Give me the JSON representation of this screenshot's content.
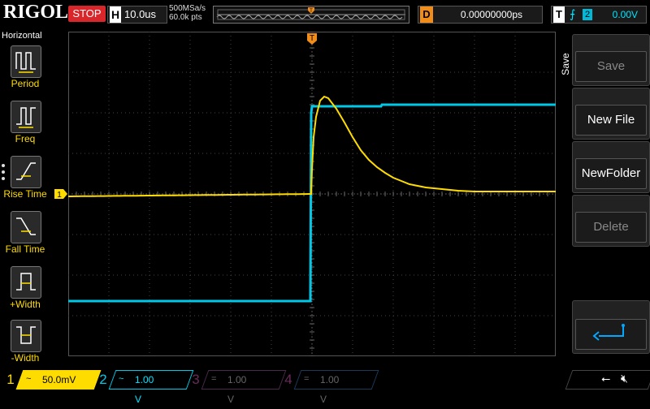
{
  "brand": "RIGOL",
  "status": "STOP",
  "horizontal": {
    "key": "H",
    "timebase": "10.0us",
    "sample_rate": "500MSa/s",
    "memory_depth": "60.0k pts"
  },
  "delay": {
    "key": "D",
    "value": "0.00000000ps"
  },
  "trigger": {
    "key": "T",
    "source": "2",
    "level": "0.00V"
  },
  "left_menu": {
    "title": "Horizontal",
    "items": [
      {
        "label": "Period",
        "icon": "period-icon"
      },
      {
        "label": "Freq",
        "icon": "frequency-icon"
      },
      {
        "label": "Rise Time",
        "icon": "rise-time-icon"
      },
      {
        "label": "Fall Time",
        "icon": "fall-time-icon"
      },
      {
        "label": "+Width",
        "icon": "positive-width-icon"
      },
      {
        "label": "-Width",
        "icon": "negative-width-icon"
      }
    ]
  },
  "right_menu": {
    "tab_label": "Save",
    "keys": [
      {
        "label": "Save",
        "enabled": false
      },
      {
        "label": "New File",
        "enabled": true
      },
      {
        "label": "NewFolder",
        "enabled": true
      },
      {
        "label": "Delete",
        "enabled": false
      }
    ],
    "enter_icon": "enter-arrow-icon"
  },
  "channels": [
    {
      "num": "1",
      "coupling": "~",
      "scale": "50.0mV",
      "active": true,
      "color": "#ffdc00"
    },
    {
      "num": "2",
      "coupling": "~",
      "scale": "1.00 V",
      "active": true,
      "color": "#00c8e6"
    },
    {
      "num": "3",
      "coupling": "=",
      "scale": "1.00 V",
      "active": false,
      "color": "#6a2a5a"
    },
    {
      "num": "4",
      "coupling": "=",
      "scale": "1.00 V",
      "active": false,
      "color": "#1b3a5a"
    }
  ],
  "markers": {
    "trigger_position": "T",
    "ch1_ground": "1"
  },
  "colors": {
    "ch1": "#ffdc00",
    "ch2": "#00c8e6",
    "trigger_marker": "#f08c1a",
    "stop": "#d8262b"
  }
}
